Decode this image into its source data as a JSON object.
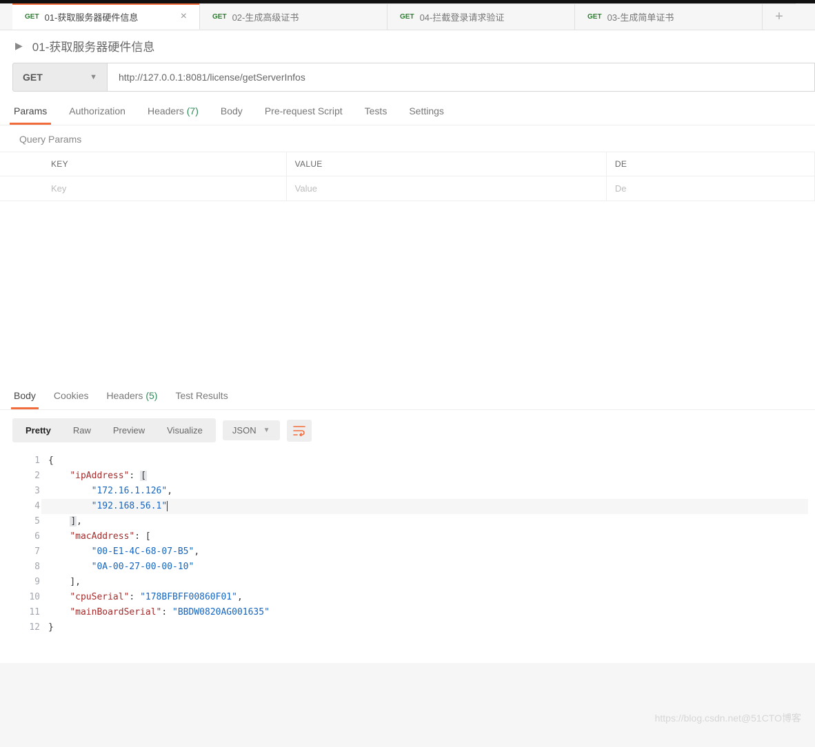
{
  "tabs": [
    {
      "method": "GET",
      "label": "01-获取服务器硬件信息",
      "active": true
    },
    {
      "method": "GET",
      "label": "02-生成高级证书",
      "active": false
    },
    {
      "method": "GET",
      "label": "04-拦截登录请求验证",
      "active": false
    },
    {
      "method": "GET",
      "label": "03-生成简单证书",
      "active": false
    }
  ],
  "request_title": "01-获取服务器硬件信息",
  "method_selected": "GET",
  "url": "http://127.0.0.1:8081/license/getServerInfos",
  "req_tabs": {
    "params": "Params",
    "authorization": "Authorization",
    "headers": "Headers",
    "headers_count": "(7)",
    "body": "Body",
    "prerequest": "Pre-request Script",
    "tests": "Tests",
    "settings": "Settings"
  },
  "query_params_label": "Query Params",
  "param_headers": {
    "key": "KEY",
    "value": "VALUE",
    "description": "DE"
  },
  "param_placeholder": {
    "key": "Key",
    "value": "Value",
    "description": "De"
  },
  "resp_tabs": {
    "body": "Body",
    "cookies": "Cookies",
    "headers": "Headers",
    "headers_count": "(5)",
    "tests": "Test Results"
  },
  "view_modes": {
    "pretty": "Pretty",
    "raw": "Raw",
    "preview": "Preview",
    "visualize": "Visualize"
  },
  "format_selected": "JSON",
  "response_json": {
    "ipAddress": [
      "172.16.1.126",
      "192.168.56.1"
    ],
    "macAddress": [
      "00-E1-4C-68-07-B5",
      "0A-00-27-00-00-10"
    ],
    "cpuSerial": "178BFBFF00860F01",
    "mainBoardSerial": "BBDW0820AG001635"
  },
  "code_lines": [
    "{",
    "    \"ipAddress\": [",
    "        \"172.16.1.126\",",
    "        \"192.168.56.1\"",
    "    ],",
    "    \"macAddress\": [",
    "        \"00-E1-4C-68-07-B5\",",
    "        \"0A-00-27-00-00-10\"",
    "    ],",
    "    \"cpuSerial\": \"178BFBFF00860F01\",",
    "    \"mainBoardSerial\": \"BBDW0820AG001635\"",
    "}"
  ],
  "watermark": "https://blog.csdn.net@51CTO博客"
}
